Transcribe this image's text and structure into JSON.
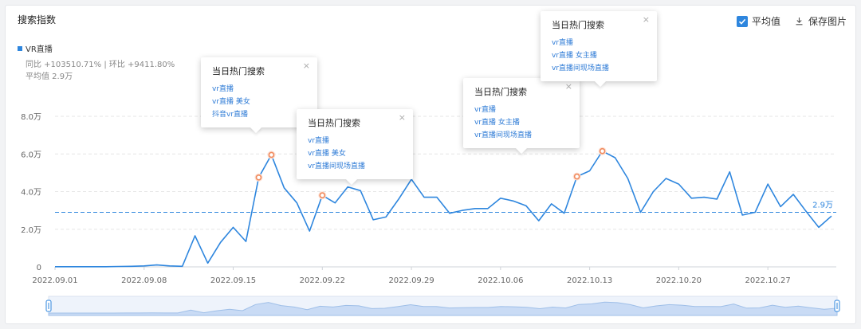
{
  "header": {
    "title": "搜索指数"
  },
  "toolbar": {
    "avg_label": "平均值",
    "avg_checked": true,
    "save_label": "保存图片"
  },
  "legend": {
    "series": "VR直播",
    "yoy": "同比 +103510.71% | 环比 +9411.80%",
    "avg": "平均值 2.9万"
  },
  "chart_data": {
    "type": "line",
    "x_tick_labels": [
      "2022.09.01",
      "2022.09.08",
      "2022.09.15",
      "2022.09.22",
      "2022.09.29",
      "2022.10.06",
      "2022.10.13",
      "2022.10.20",
      "2022.10.27"
    ],
    "y_tick_labels": [
      "0",
      "2.0万",
      "4.0万",
      "6.0万",
      "8.0万"
    ],
    "ylim": [
      0,
      80000
    ],
    "grid": true,
    "average": 29000,
    "average_label": "2.9万",
    "series": [
      {
        "name": "VR直播",
        "color": "#2e86de",
        "values": [
          100,
          100,
          100,
          100,
          100,
          200,
          300,
          500,
          1000,
          500,
          300,
          16500,
          2000,
          13000,
          21000,
          13500,
          47500,
          59500,
          42000,
          34000,
          19000,
          38000,
          34000,
          42500,
          40500,
          25000,
          26500,
          36000,
          46500,
          37000,
          37000,
          28500,
          30000,
          31000,
          31000,
          36500,
          35000,
          32500,
          24500,
          33500,
          28500,
          48000,
          51000,
          61500,
          58000,
          47000,
          29000,
          40000,
          47000,
          44000,
          36500,
          37000,
          36000,
          50500,
          27500,
          29000,
          44000,
          32000,
          38500,
          29500,
          21000,
          27000
        ]
      }
    ],
    "highlighted_points": [
      16,
      17,
      21,
      41,
      43
    ]
  },
  "tooltips": [
    {
      "title": "当日热门搜索",
      "close": "×",
      "items": [
        "vr直播",
        "vr直播 美女",
        "抖音vr直播"
      ]
    },
    {
      "title": "当日热门搜索",
      "close": "×",
      "items": [
        "vr直播",
        "vr直播 美女",
        "vr直播间现场直播"
      ]
    },
    {
      "title": "当日热门搜索",
      "close": "×",
      "items": [
        "vr直播",
        "vr直播 女主播",
        "vr直播间现场直播"
      ]
    },
    {
      "title": "当日热门搜索",
      "close": "×",
      "items": [
        "vr直播",
        "vr直播 女主播",
        "vr直播间现场直播"
      ]
    }
  ],
  "colors": {
    "accent": "#2e86de",
    "highlight": "#f08a5d",
    "grid": "#e6e6e6"
  }
}
